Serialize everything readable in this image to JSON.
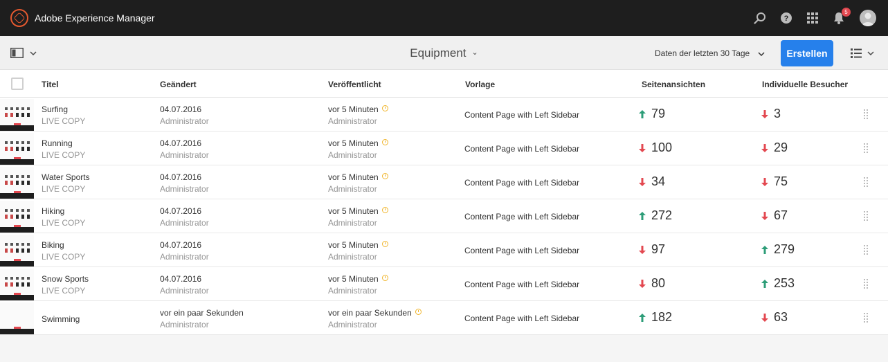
{
  "shell": {
    "app_title": "Adobe Experience Manager",
    "notification_count": "5"
  },
  "actionbar": {
    "page_title": "Equipment",
    "date_range": "Daten der letzten 30 Tage",
    "create_label": "Erstellen"
  },
  "table": {
    "headers": {
      "title": "Titel",
      "modified": "Geändert",
      "published": "Veröffentlicht",
      "template": "Vorlage",
      "pageviews": "Seitenansichten",
      "visitors": "Individuelle Besucher"
    },
    "rows": [
      {
        "title": "Surfing",
        "status": "LIVE COPY",
        "modified": "04.07.2016",
        "modified_by": "Administrator",
        "published": "vor 5 Minuten",
        "published_by": "Administrator",
        "template": "Content Page with Left Sidebar",
        "pageviews": "79",
        "pageviews_trend": "up",
        "visitors": "3",
        "visitors_trend": "down"
      },
      {
        "title": "Running",
        "status": "LIVE COPY",
        "modified": "04.07.2016",
        "modified_by": "Administrator",
        "published": "vor 5 Minuten",
        "published_by": "Administrator",
        "template": "Content Page with Left Sidebar",
        "pageviews": "100",
        "pageviews_trend": "down",
        "visitors": "29",
        "visitors_trend": "down"
      },
      {
        "title": "Water Sports",
        "status": "LIVE COPY",
        "modified": "04.07.2016",
        "modified_by": "Administrator",
        "published": "vor 5 Minuten",
        "published_by": "Administrator",
        "template": "Content Page with Left Sidebar",
        "pageviews": "34",
        "pageviews_trend": "down",
        "visitors": "75",
        "visitors_trend": "down"
      },
      {
        "title": "Hiking",
        "status": "LIVE COPY",
        "modified": "04.07.2016",
        "modified_by": "Administrator",
        "published": "vor 5 Minuten",
        "published_by": "Administrator",
        "template": "Content Page with Left Sidebar",
        "pageviews": "272",
        "pageviews_trend": "up",
        "visitors": "67",
        "visitors_trend": "down"
      },
      {
        "title": "Biking",
        "status": "LIVE COPY",
        "modified": "04.07.2016",
        "modified_by": "Administrator",
        "published": "vor 5 Minuten",
        "published_by": "Administrator",
        "template": "Content Page with Left Sidebar",
        "pageviews": "97",
        "pageviews_trend": "down",
        "visitors": "279",
        "visitors_trend": "up"
      },
      {
        "title": "Snow Sports",
        "status": "LIVE COPY",
        "modified": "04.07.2016",
        "modified_by": "Administrator",
        "published": "vor 5 Minuten",
        "published_by": "Administrator",
        "template": "Content Page with Left Sidebar",
        "pageviews": "80",
        "pageviews_trend": "down",
        "visitors": "253",
        "visitors_trend": "up"
      },
      {
        "title": "Swimming",
        "status": "",
        "modified": "vor ein paar Sekunden",
        "modified_by": "Administrator",
        "published": "vor ein paar Sekunden",
        "published_by": "Administrator",
        "template": "Content Page with Left Sidebar",
        "pageviews": "182",
        "pageviews_trend": "up",
        "visitors": "63",
        "visitors_trend": "down"
      }
    ]
  },
  "colors": {
    "accent": "#2680eb",
    "trend_up": "#2d9d78",
    "trend_down": "#e34850",
    "published_clock": "#f0b429"
  },
  "icons": {
    "logo": "aem-logo-icon",
    "search": "search-icon",
    "help": "help-icon",
    "solutions": "grid-icon",
    "notifications": "bell-icon",
    "user": "avatar",
    "rail": "rail-toggle-icon",
    "view": "list-view-icon",
    "row_handle": "drag-handle-icon"
  }
}
